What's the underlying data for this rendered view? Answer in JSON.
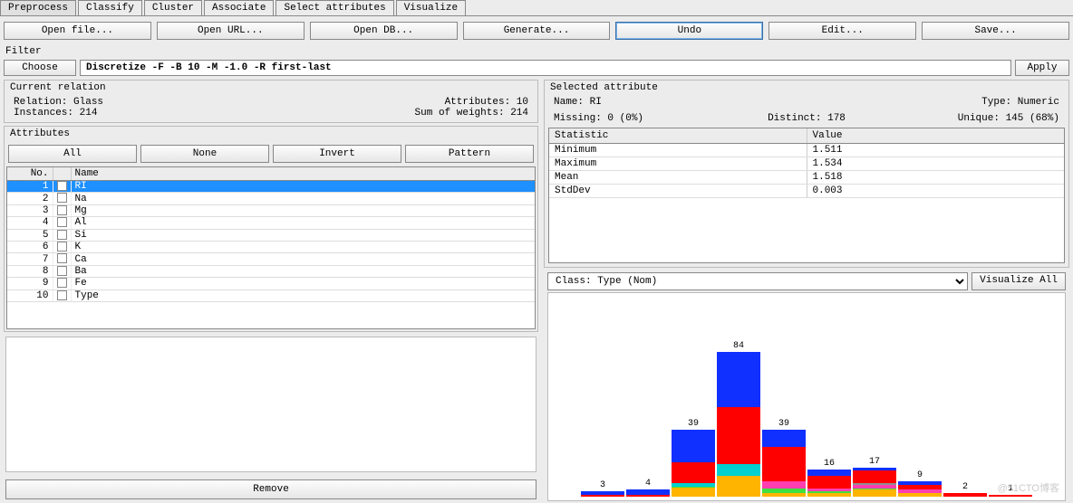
{
  "tabs": [
    "Preprocess",
    "Classify",
    "Cluster",
    "Associate",
    "Select attributes",
    "Visualize"
  ],
  "active_tab": 0,
  "buttons": {
    "open_file": "Open file...",
    "open_url": "Open URL...",
    "open_db": "Open DB...",
    "generate": "Generate...",
    "undo": "Undo",
    "edit": "Edit...",
    "save": "Save..."
  },
  "filter": {
    "title": "Filter",
    "choose": "Choose",
    "text": "Discretize -F -B 10 -M -1.0 -R first-last",
    "apply": "Apply"
  },
  "current_relation": {
    "title": "Current relation",
    "relation_label": "Relation:",
    "relation": "Glass",
    "instances_label": "Instances:",
    "instances": "214",
    "attributes_label": "Attributes:",
    "attributes": "10",
    "sow_label": "Sum of weights:",
    "sow": "214"
  },
  "attributes_panel": {
    "title": "Attributes",
    "all": "All",
    "none": "None",
    "invert": "Invert",
    "pattern": "Pattern",
    "col_no": "No.",
    "col_name": "Name",
    "rows": [
      {
        "no": "1",
        "name": "RI",
        "selected": true
      },
      {
        "no": "2",
        "name": "Na"
      },
      {
        "no": "3",
        "name": "Mg"
      },
      {
        "no": "4",
        "name": "Al"
      },
      {
        "no": "5",
        "name": "Si"
      },
      {
        "no": "6",
        "name": "K"
      },
      {
        "no": "7",
        "name": "Ca"
      },
      {
        "no": "8",
        "name": "Ba"
      },
      {
        "no": "9",
        "name": "Fe"
      },
      {
        "no": "10",
        "name": "Type"
      }
    ],
    "remove": "Remove"
  },
  "selected_attribute": {
    "title": "Selected attribute",
    "name_label": "Name:",
    "name": "RI",
    "type_label": "Type:",
    "type": "Numeric",
    "missing_label": "Missing:",
    "missing": "0 (0%)",
    "distinct_label": "Distinct:",
    "distinct": "178",
    "unique_label": "Unique:",
    "unique": "145 (68%)",
    "stat_col": "Statistic",
    "val_col": "Value",
    "stats": [
      {
        "k": "Minimum",
        "v": "1.511"
      },
      {
        "k": "Maximum",
        "v": "1.534"
      },
      {
        "k": "Mean",
        "v": "1.518"
      },
      {
        "k": "StdDev",
        "v": "0.003"
      }
    ]
  },
  "class_row": {
    "label": "Class: Type (Nom)",
    "viz": "Visualize All"
  },
  "chart_data": {
    "type": "bar",
    "title": "",
    "xlabel": "",
    "ylabel": "",
    "ylim": [
      0,
      84
    ],
    "class_colors": {
      "c1": "#1030ff",
      "c2": "#ff0000",
      "c3": "#00d0d0",
      "c4": "#8e8e8e",
      "c5": "#ff3eb0",
      "c6": "#40e040",
      "c7": "#ffb400"
    },
    "bars": [
      {
        "total": 3,
        "segments": [
          {
            "class": "c2",
            "v": 1
          },
          {
            "class": "c1",
            "v": 2
          }
        ]
      },
      {
        "total": 4,
        "segments": [
          {
            "class": "c2",
            "v": 1
          },
          {
            "class": "c1",
            "v": 3
          }
        ]
      },
      {
        "total": 39,
        "segments": [
          {
            "class": "c7",
            "v": 5
          },
          {
            "class": "c6",
            "v": 1
          },
          {
            "class": "c3",
            "v": 2
          },
          {
            "class": "c2",
            "v": 12
          },
          {
            "class": "c1",
            "v": 19
          }
        ]
      },
      {
        "total": 84,
        "segments": [
          {
            "class": "c7",
            "v": 12
          },
          {
            "class": "c3",
            "v": 7
          },
          {
            "class": "c2",
            "v": 33
          },
          {
            "class": "c1",
            "v": 32
          }
        ]
      },
      {
        "total": 39,
        "segments": [
          {
            "class": "c7",
            "v": 2
          },
          {
            "class": "c6",
            "v": 3
          },
          {
            "class": "c5",
            "v": 4
          },
          {
            "class": "c2",
            "v": 20
          },
          {
            "class": "c1",
            "v": 10
          }
        ]
      },
      {
        "total": 16,
        "segments": [
          {
            "class": "c7",
            "v": 2
          },
          {
            "class": "c6",
            "v": 1
          },
          {
            "class": "c5",
            "v": 2
          },
          {
            "class": "c2",
            "v": 7
          },
          {
            "class": "c1",
            "v": 4
          }
        ]
      },
      {
        "total": 17,
        "segments": [
          {
            "class": "c7",
            "v": 4
          },
          {
            "class": "c6",
            "v": 1
          },
          {
            "class": "c5",
            "v": 2
          },
          {
            "class": "c4",
            "v": 1
          },
          {
            "class": "c2",
            "v": 7
          },
          {
            "class": "c1",
            "v": 2
          }
        ]
      },
      {
        "total": 9,
        "segments": [
          {
            "class": "c7",
            "v": 2
          },
          {
            "class": "c5",
            "v": 2
          },
          {
            "class": "c2",
            "v": 3
          },
          {
            "class": "c1",
            "v": 2
          }
        ]
      },
      {
        "total": 2,
        "segments": [
          {
            "class": "c2",
            "v": 2
          }
        ]
      },
      {
        "total": 1,
        "segments": [
          {
            "class": "c2",
            "v": 1
          }
        ]
      }
    ]
  },
  "watermark": "@51CTO博客"
}
